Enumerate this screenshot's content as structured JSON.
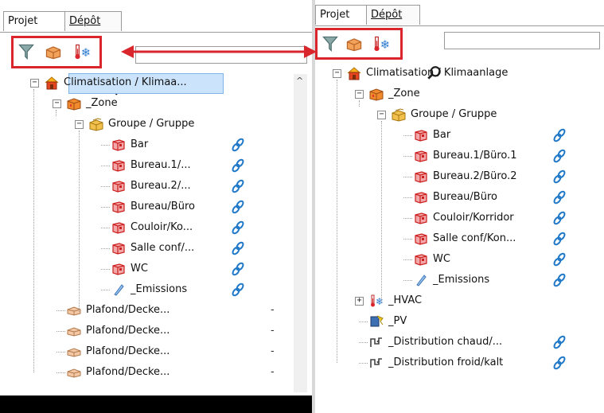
{
  "left": {
    "tabs": [
      {
        "label": "Projet",
        "active": true
      },
      {
        "label": "Dépôt",
        "active": false
      }
    ],
    "toolbar": {
      "icons": [
        "filter-icon",
        "box-icon",
        "thermo-snow-icon",
        "search-icon"
      ],
      "search_value": ""
    },
    "tree": [
      {
        "label": "Climatisation / Klimaa...",
        "icon": "house-icon",
        "selected": true,
        "expander": "−"
      },
      {
        "label": "_Zone",
        "icon": "zone-icon",
        "expander": "−"
      },
      {
        "label": "Groupe / Gruppe",
        "icon": "group-icon",
        "expander": "−"
      },
      {
        "label": "Bar",
        "icon": "room-icon",
        "link": true
      },
      {
        "label": "Bureau.1/...",
        "icon": "room-icon",
        "link": true
      },
      {
        "label": "Bureau.2/...",
        "icon": "room-icon",
        "link": true
      },
      {
        "label": "Bureau/Büro",
        "icon": "room-icon",
        "link": true
      },
      {
        "label": "Couloir/Ko...",
        "icon": "room-icon",
        "link": true
      },
      {
        "label": "Salle conf/...",
        "icon": "room-icon",
        "link": true
      },
      {
        "label": "WC",
        "icon": "room-icon",
        "link": true
      },
      {
        "label": "_Emissions",
        "icon": "emission-icon",
        "link": true
      },
      {
        "label": "Plafond/Decke...",
        "icon": "ceiling-icon",
        "suffix": "-"
      },
      {
        "label": "Plafond/Decke...",
        "icon": "ceiling-icon",
        "suffix": "-"
      },
      {
        "label": "Plafond/Decke...",
        "icon": "ceiling-icon",
        "suffix": "-"
      },
      {
        "label": "Plafond/Decke...",
        "icon": "ceiling-icon",
        "suffix": "-"
      }
    ]
  },
  "right": {
    "tabs": [
      {
        "label": "Projet",
        "active": true
      },
      {
        "label": "Dépôt",
        "active": false
      }
    ],
    "toolbar": {
      "icons": [
        "filter-icon",
        "box-icon",
        "thermo-snow-icon",
        "search-icon"
      ],
      "search_value": ""
    },
    "tree": [
      {
        "label": "Climatisation / Klimaanlage",
        "icon": "house-icon",
        "expander": "−"
      },
      {
        "label": "_Zone",
        "icon": "zone-icon",
        "expander": "−"
      },
      {
        "label": "Groupe / Gruppe",
        "icon": "group-icon",
        "expander": "−"
      },
      {
        "label": "Bar",
        "icon": "room-icon",
        "link": true
      },
      {
        "label": "Bureau.1/Büro.1",
        "icon": "room-icon",
        "link": true
      },
      {
        "label": "Bureau.2/Büro.2",
        "icon": "room-icon",
        "link": true
      },
      {
        "label": "Bureau/Büro",
        "icon": "room-icon",
        "link": true
      },
      {
        "label": "Couloir/Korridor",
        "icon": "room-icon",
        "link": true
      },
      {
        "label": "Salle conf/Kon...",
        "icon": "room-icon",
        "link": true
      },
      {
        "label": "WC",
        "icon": "room-icon",
        "link": true
      },
      {
        "label": "_Emissions",
        "icon": "emission-icon",
        "link": true
      },
      {
        "label": "_HVAC",
        "icon": "thermo-snow-icon",
        "expander": "+"
      },
      {
        "label": "_PV",
        "icon": "pv-icon"
      },
      {
        "label": "_Distribution chaud/...",
        "icon": "distribution-icon",
        "link": true
      },
      {
        "label": "_Distribution froid/kalt",
        "icon": "distribution-icon",
        "link": true
      }
    ]
  },
  "colors": {
    "highlight_red": "#d9262c",
    "selection": "#cce4fb",
    "link_blue": "#1f78c8",
    "room_red": "#d9262c"
  }
}
